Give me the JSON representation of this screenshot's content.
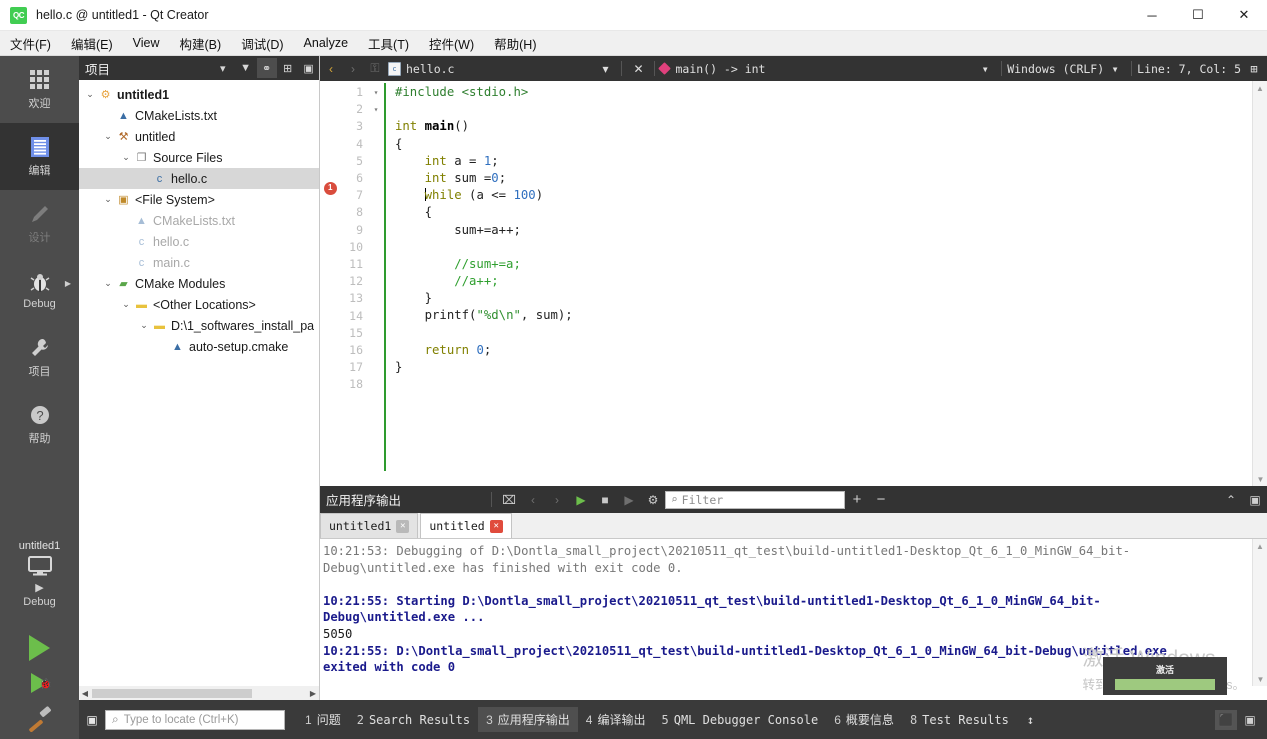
{
  "window": {
    "logo": "QC",
    "title": "hello.c @ untitled1 - Qt Creator",
    "minimize": "─",
    "maximize": "☐",
    "close": "✕"
  },
  "menubar": [
    {
      "label": "文件(F)"
    },
    {
      "label": "编辑(E)"
    },
    {
      "label": "View"
    },
    {
      "label": "构建(B)"
    },
    {
      "label": "调试(D)"
    },
    {
      "label": "Analyze"
    },
    {
      "label": "工具(T)"
    },
    {
      "label": "控件(W)"
    },
    {
      "label": "帮助(H)"
    }
  ],
  "modebar": {
    "items": [
      {
        "label": "欢迎",
        "icon": "grid-icon",
        "state": "normal"
      },
      {
        "label": "编辑",
        "icon": "document-icon",
        "state": "active"
      },
      {
        "label": "设计",
        "icon": "pencil-icon",
        "state": "disabled"
      },
      {
        "label": "Debug",
        "icon": "bug-icon",
        "state": "normal"
      },
      {
        "label": "项目",
        "icon": "wrench-icon",
        "state": "normal"
      },
      {
        "label": "帮助",
        "icon": "question-icon",
        "state": "normal"
      }
    ],
    "run_section": {
      "kit_name": "untitled1",
      "build_config": "Debug",
      "target_icon": "monitor-icon",
      "run_label": "run-button",
      "debug_label": "start-debugging-button",
      "build_label": "build-button"
    }
  },
  "project_panel": {
    "header": "项目",
    "tools": [
      {
        "name": "filter-icon",
        "glyph": "▼"
      },
      {
        "name": "link-with-editor-icon",
        "glyph": "⚭"
      },
      {
        "name": "expand-all-icon",
        "glyph": "⊞"
      },
      {
        "name": "hide-sidebar-icon",
        "glyph": "▣"
      }
    ],
    "dropdown_glyph": "▾",
    "tree": [
      {
        "indent": 0,
        "chev": "⌄",
        "icon": "project-icon",
        "glyph": "⚙",
        "color": "#e8a33d",
        "label": "untitled1",
        "bold": true,
        "grey": false,
        "selected": false
      },
      {
        "indent": 1,
        "chev": "",
        "icon": "cmake-file-icon",
        "glyph": "▲",
        "color": "#3b6ea5",
        "label": "CMakeLists.txt",
        "bold": false,
        "grey": false,
        "selected": false
      },
      {
        "indent": 1,
        "chev": "⌄",
        "icon": "target-icon",
        "glyph": "⚒",
        "color": "#b06a2a",
        "label": "untitled",
        "bold": false,
        "grey": false,
        "selected": false
      },
      {
        "indent": 2,
        "chev": "⌄",
        "icon": "folder-files-icon",
        "glyph": "❐",
        "color": "#7a7a7a",
        "label": "Source Files",
        "bold": false,
        "grey": false,
        "selected": false
      },
      {
        "indent": 3,
        "chev": "",
        "icon": "c-file-icon",
        "glyph": "c",
        "color": "#3b6ea5",
        "label": "hello.c",
        "bold": false,
        "grey": false,
        "selected": true
      },
      {
        "indent": 1,
        "chev": "⌄",
        "icon": "filesystem-icon",
        "glyph": "▣",
        "color": "#c08a2a",
        "label": "<File System>",
        "bold": false,
        "grey": false,
        "selected": false
      },
      {
        "indent": 2,
        "chev": "",
        "icon": "cmake-file-icon",
        "glyph": "▲",
        "color": "#3b6ea5",
        "label": "CMakeLists.txt",
        "bold": false,
        "grey": true,
        "selected": false
      },
      {
        "indent": 2,
        "chev": "",
        "icon": "c-file-icon",
        "glyph": "c",
        "color": "#3b6ea5",
        "label": "hello.c",
        "bold": false,
        "grey": true,
        "selected": false
      },
      {
        "indent": 2,
        "chev": "",
        "icon": "c-file-icon",
        "glyph": "c",
        "color": "#3b6ea5",
        "label": "main.c",
        "bold": false,
        "grey": true,
        "selected": false
      },
      {
        "indent": 1,
        "chev": "⌄",
        "icon": "cmake-modules-icon",
        "glyph": "▰",
        "color": "#5aa64a",
        "label": "CMake Modules",
        "bold": false,
        "grey": false,
        "selected": false
      },
      {
        "indent": 2,
        "chev": "⌄",
        "icon": "folder-icon",
        "glyph": "▬",
        "color": "#e8c23d",
        "label": "<Other Locations>",
        "bold": false,
        "grey": false,
        "selected": false
      },
      {
        "indent": 3,
        "chev": "⌄",
        "icon": "folder-icon",
        "glyph": "▬",
        "color": "#e8c23d",
        "label": "D:\\1_softwares_install_pa",
        "bold": false,
        "grey": false,
        "selected": false
      },
      {
        "indent": 4,
        "chev": "",
        "icon": "cmake-file-icon",
        "glyph": "▲",
        "color": "#3b6ea5",
        "label": "auto-setup.cmake",
        "bold": false,
        "grey": false,
        "selected": false
      }
    ]
  },
  "editor": {
    "toolbar": {
      "back_icon": "‹",
      "forward_icon": "›",
      "lock_icon": "⚿",
      "file_name": "hello.c",
      "file_dropdown": "▾",
      "close_file": "✕",
      "symbol": "main() -> int",
      "symbol_dropdown": "▾",
      "line_ending": "Windows (CRLF)",
      "line_ending_dropdown": "▾",
      "cursor_position": "Line: 7, Col: 5",
      "split_icon": "⊞"
    },
    "line_numbers": [
      "1",
      "2",
      "3",
      "4",
      "5",
      "6",
      "7",
      "8",
      "9",
      "10",
      "11",
      "12",
      "13",
      "14",
      "15",
      "16",
      "17",
      "18"
    ],
    "fold_markers": {
      "3": "▾",
      "7": "▾"
    },
    "breakpoint_line": 7,
    "breakpoint_glyph": "1",
    "code_lines": [
      "#include <stdio.h>",
      "",
      "int main()",
      "{",
      "    int a = 1;",
      "    int sum =0;",
      "    while (a <= 100)",
      "    {",
      "        sum+=a++;",
      "",
      "        //sum+=a;",
      "        //a++;",
      "    }",
      "    printf(\"%d\\n\", sum);",
      "",
      "    return 0;",
      "}",
      ""
    ]
  },
  "output_pane": {
    "title": "应用程序输出",
    "toolbar": [
      {
        "name": "clear-output-icon",
        "glyph": "⌧",
        "dim": false
      },
      {
        "name": "prev-item-icon",
        "glyph": "‹",
        "dim": true
      },
      {
        "name": "next-item-icon",
        "glyph": "›",
        "dim": true
      },
      {
        "name": "run-icon",
        "glyph": "▶",
        "dim": false
      },
      {
        "name": "stop-icon",
        "glyph": "■",
        "dim": false
      },
      {
        "name": "attach-icon",
        "glyph": "▶",
        "dim": true
      },
      {
        "name": "settings-gear-icon",
        "glyph": "⚙",
        "dim": false
      }
    ],
    "filter_placeholder": "Filter",
    "filter_icon": "search-icon",
    "maximize_icon": "⌃",
    "close_icon": "▣",
    "tabs": [
      {
        "label": "untitled1",
        "active": false,
        "close_red": false
      },
      {
        "label": "untitled",
        "active": true,
        "close_red": true
      }
    ],
    "lines": [
      {
        "text": "10:21:53: Debugging of D:\\Dontla_small_project\\20210511_qt_test\\build-untitled1-Desktop_Qt_6_1_0_MinGW_64_bit-Debug\\untitled.exe has finished with exit code 0.",
        "style": "grey"
      },
      {
        "text": "",
        "style": "grey"
      },
      {
        "text": "10:21:55: Starting D:\\Dontla_small_project\\20210511_qt_test\\build-untitled1-Desktop_Qt_6_1_0_MinGW_64_bit-Debug\\untitled.exe ...",
        "style": "hl"
      },
      {
        "text": "5050",
        "style": "plain"
      },
      {
        "text": "10:21:55: D:\\Dontla_small_project\\20210511_qt_test\\build-untitled1-Desktop_Qt_6_1_0_MinGW_64_bit-Debug\\untitled.exe exited with code 0",
        "style": "hl"
      }
    ]
  },
  "statusbar": {
    "sidebar_toggle_icon": "▣",
    "locate_placeholder": "Type to locate (Ctrl+K)",
    "locate_icon": "search-icon",
    "tabs": [
      {
        "num": "1",
        "label": "问题",
        "cn": true,
        "active": false
      },
      {
        "num": "2",
        "label": "Search Results",
        "cn": false,
        "active": false
      },
      {
        "num": "3",
        "label": "应用程序输出",
        "cn": true,
        "active": true
      },
      {
        "num": "4",
        "label": "编译输出",
        "cn": true,
        "active": false
      },
      {
        "num": "5",
        "label": "QML Debugger Console",
        "cn": false,
        "active": false
      },
      {
        "num": "6",
        "label": "概要信息",
        "cn": true,
        "active": false
      },
      {
        "num": "8",
        "label": "Test Results",
        "cn": false,
        "active": false
      }
    ],
    "updown_glyph": "↕",
    "right_buttons": [
      {
        "name": "output-pane-toggle-icon",
        "glyph": "⬛",
        "on": true
      },
      {
        "name": "sidebar-right-toggle-icon",
        "glyph": "▣",
        "on": false
      }
    ]
  },
  "watermark": {
    "line1": "激活 Windows",
    "line2": "转到“设置”以激活 Windows。"
  },
  "tooltip": {
    "label": "激活"
  }
}
